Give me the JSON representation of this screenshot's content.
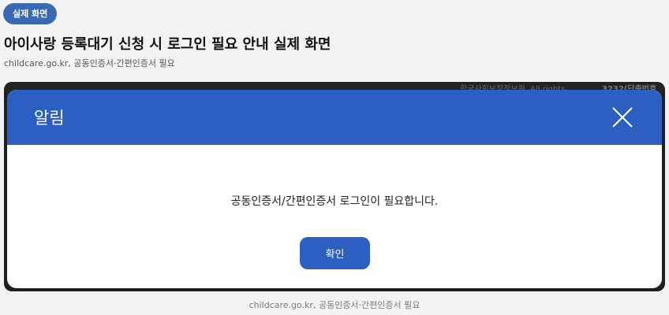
{
  "badge": {
    "label": "실제 화면"
  },
  "page": {
    "title": "아이사랑 등록대기 신청 시 로그인 필요 안내 실제 화면",
    "subtitle": "childcare.go.kr, 공동인증서·간편인증서 필요"
  },
  "background": {
    "org_text": "한국사회보장정보원. All rights",
    "phone_text": "3232(단축번호"
  },
  "modal": {
    "title": "알림",
    "message": "공동인증서/간편인증서 로그인이 필요합니다.",
    "confirm_label": "확인",
    "close_icon": "close-icon"
  },
  "footer": {
    "caption": "childcare.go.kr, 공동인증서·간편인증서 필요"
  },
  "colors": {
    "badge": "#3a69b4",
    "modal_header": "#2d5fc2",
    "confirm_button": "#2d5fc2"
  }
}
